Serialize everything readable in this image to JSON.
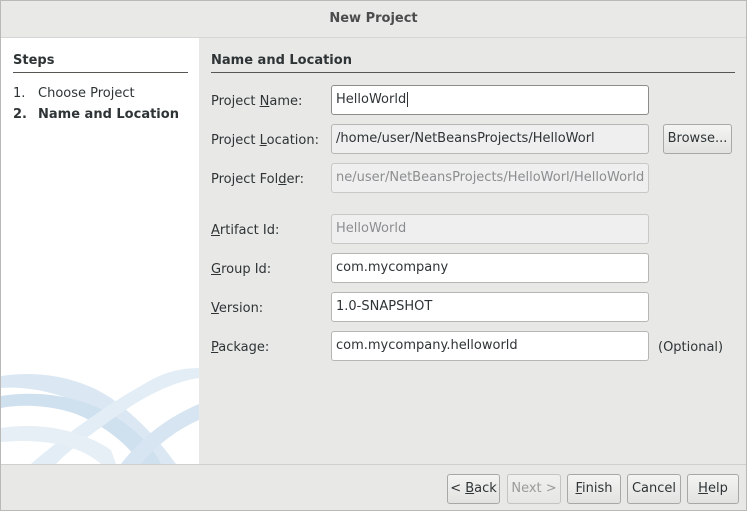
{
  "window": {
    "title": "New Project"
  },
  "steps": {
    "heading": "Steps",
    "items": [
      {
        "num": "1.",
        "label": "Choose Project"
      },
      {
        "num": "2.",
        "label": "Name and Location"
      }
    ]
  },
  "form": {
    "heading": "Name and Location",
    "project_name": {
      "label_pre": "Project ",
      "label_key": "N",
      "label_post": "ame:",
      "value": "HelloWorld"
    },
    "project_location": {
      "label_pre": "Project ",
      "label_key": "L",
      "label_post": "ocation:",
      "value": "/home/user/NetBeansProjects/HelloWorl"
    },
    "project_folder": {
      "label_pre": "Project Fol",
      "label_key": "d",
      "label_post": "er:",
      "value": "ne/user/NetBeansProjects/HelloWorl/HelloWorld"
    },
    "artifact_id": {
      "label_key": "A",
      "label_post": "rtifact Id:",
      "value": "HelloWorld"
    },
    "group_id": {
      "label_key": "G",
      "label_post": "roup Id:",
      "value": "com.mycompany"
    },
    "version": {
      "label_key": "V",
      "label_post": "ersion:",
      "value": "1.0-SNAPSHOT"
    },
    "package": {
      "label_key": "P",
      "label_post": "ackage:",
      "value": "com.mycompany.helloworld",
      "optional": "(Optional)"
    },
    "browse_label": "Browse..."
  },
  "footer": {
    "back_pre": "< ",
    "back_key": "B",
    "back_post": "ack",
    "next_label": "Next >",
    "finish_key": "F",
    "finish_post": "inish",
    "cancel_label": "Cancel",
    "help_key": "H",
    "help_post": "elp"
  }
}
